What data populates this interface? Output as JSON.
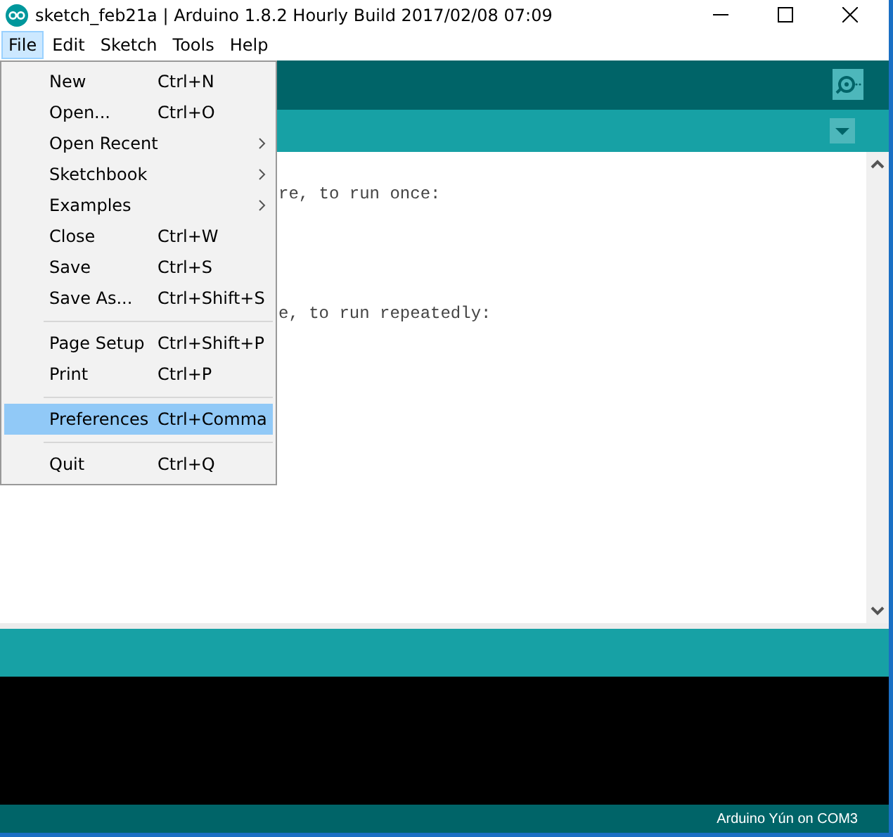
{
  "window": {
    "title": "sketch_feb21a | Arduino 1.8.2 Hourly Build 2017/02/08 07:09"
  },
  "menu_bar": [
    {
      "label": "File",
      "selected": true
    },
    {
      "label": "Edit",
      "selected": false
    },
    {
      "label": "Sketch",
      "selected": false
    },
    {
      "label": "Tools",
      "selected": false
    },
    {
      "label": "Help",
      "selected": false
    }
  ],
  "file_menu": [
    {
      "kind": "item",
      "label": "New",
      "shortcut": "Ctrl+N",
      "submenu": false,
      "selected": false
    },
    {
      "kind": "item",
      "label": "Open...",
      "shortcut": "Ctrl+O",
      "submenu": false,
      "selected": false
    },
    {
      "kind": "item",
      "label": "Open Recent",
      "submenu": true,
      "selected": false
    },
    {
      "kind": "item",
      "label": "Sketchbook",
      "submenu": true,
      "selected": false
    },
    {
      "kind": "item",
      "label": "Examples",
      "submenu": true,
      "selected": false
    },
    {
      "kind": "item",
      "label": "Close",
      "shortcut": "Ctrl+W",
      "submenu": false,
      "selected": false
    },
    {
      "kind": "item",
      "label": "Save",
      "shortcut": "Ctrl+S",
      "submenu": false,
      "selected": false
    },
    {
      "kind": "item",
      "label": "Save As...",
      "shortcut": "Ctrl+Shift+S",
      "submenu": false,
      "selected": false
    },
    {
      "kind": "separator"
    },
    {
      "kind": "item",
      "label": "Page Setup",
      "shortcut": "Ctrl+Shift+P",
      "submenu": false,
      "selected": false
    },
    {
      "kind": "item",
      "label": "Print",
      "shortcut": "Ctrl+P",
      "submenu": false,
      "selected": false
    },
    {
      "kind": "separator"
    },
    {
      "kind": "item",
      "label": "Preferences",
      "shortcut": "Ctrl+Comma",
      "submenu": false,
      "selected": true
    },
    {
      "kind": "separator"
    },
    {
      "kind": "item",
      "label": "Quit",
      "shortcut": "Ctrl+Q",
      "submenu": false,
      "selected": false
    }
  ],
  "editor": {
    "setup_comment": "re, to run once:",
    "loop_comment": "e, to run repeatedly:"
  },
  "status_bar": {
    "board": "Arduino Yún on COM3"
  }
}
